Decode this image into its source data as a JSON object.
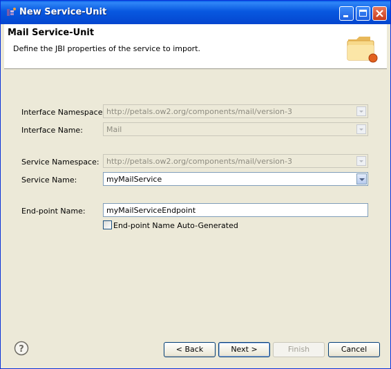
{
  "window": {
    "title": "New Service-Unit"
  },
  "banner": {
    "title": "Mail Service-Unit",
    "description": "Define the JBI properties of the service to import."
  },
  "form": {
    "interface_namespace": {
      "label": "Interface Namespace:",
      "value": "http://petals.ow2.org/components/mail/version-3"
    },
    "interface_name": {
      "label": "Interface Name:",
      "value": "Mail"
    },
    "service_namespace": {
      "label": "Service Namespace:",
      "value": "http://petals.ow2.org/components/mail/version-3"
    },
    "service_name": {
      "label": "Service Name:",
      "value": "myMailService"
    },
    "endpoint_name": {
      "label": "End-point Name:",
      "value": "myMailServiceEndpoint"
    },
    "endpoint_autogen": {
      "label": "End-point Name Auto-Generated",
      "checked": false
    }
  },
  "buttons": {
    "back": "< Back",
    "next": "Next >",
    "finish": "Finish",
    "cancel": "Cancel"
  }
}
